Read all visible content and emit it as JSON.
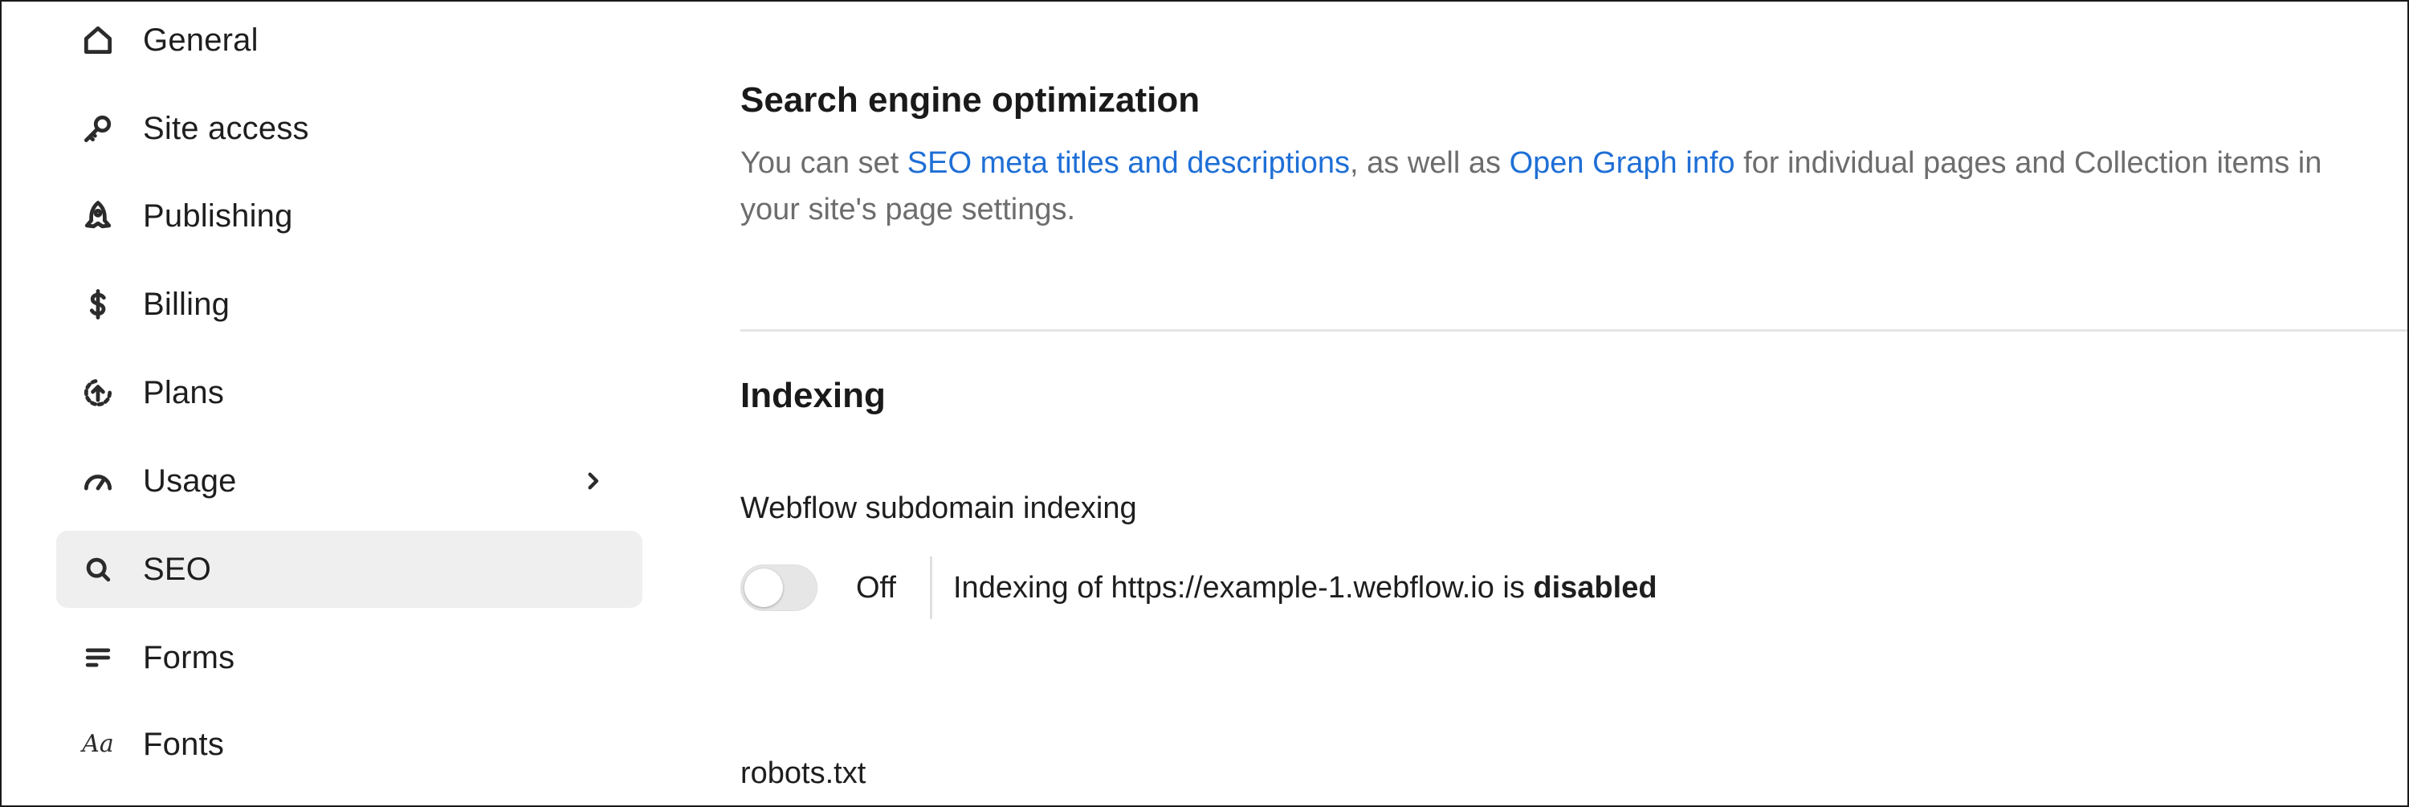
{
  "sidebar": {
    "items": [
      {
        "label": "General",
        "icon": "home-icon"
      },
      {
        "label": "Site access",
        "icon": "key-icon"
      },
      {
        "label": "Publishing",
        "icon": "rocket-icon"
      },
      {
        "label": "Billing",
        "icon": "dollar-icon"
      },
      {
        "label": "Plans",
        "icon": "plans-upgrade-icon"
      },
      {
        "label": "Usage",
        "icon": "gauge-icon"
      },
      {
        "label": "SEO",
        "icon": "search-icon"
      },
      {
        "label": "Forms",
        "icon": "forms-lines-icon"
      },
      {
        "label": "Fonts",
        "icon": "fonts-aa-icon",
        "glyph": "Aa"
      }
    ],
    "active": "SEO"
  },
  "seo": {
    "title": "Search engine optimization",
    "desc_part1": "You can set ",
    "link1": "SEO meta titles and descriptions",
    "desc_part2": ", as well as ",
    "link2": "Open Graph info",
    "desc_part3": " for individual pages and Collection items in your site's page settings."
  },
  "indexing": {
    "title": "Indexing",
    "subdomain_label": "Webflow subdomain indexing",
    "toggle_state": "Off",
    "status_prefix": "Indexing of https://example-1.webflow.io is ",
    "status_value": "disabled",
    "robots_label": "robots.txt"
  },
  "colors": {
    "link": "#1f6fd6",
    "active_bg": "#efefef",
    "muted_text": "#6d6d6d"
  }
}
